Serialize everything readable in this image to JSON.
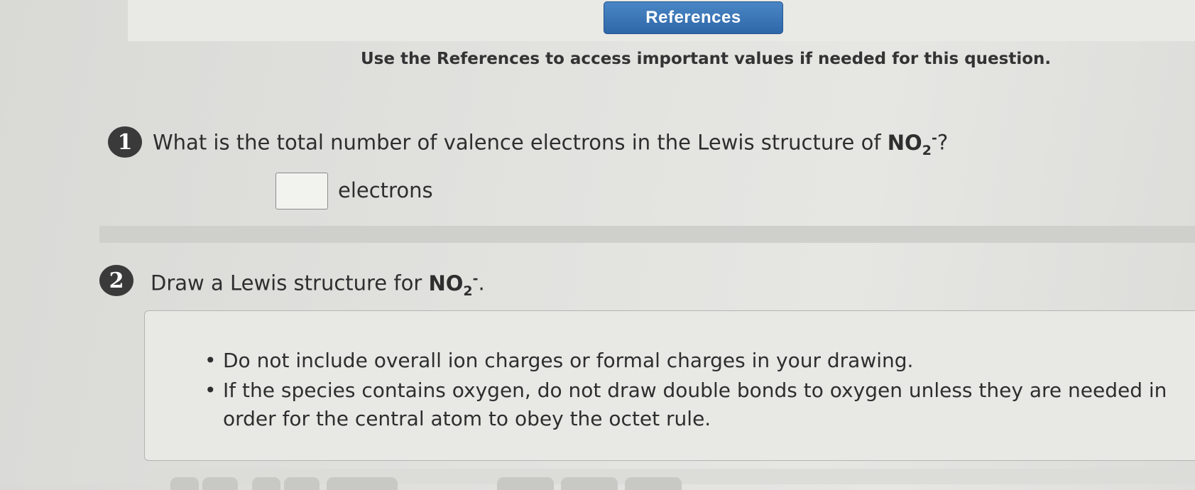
{
  "header": {
    "references_label": "References",
    "instruction": "Use the References to access important values if needed for this question."
  },
  "question1": {
    "number": "1",
    "text_before": "What is the total number of valence electrons in the Lewis structure of ",
    "formula_base": "NO",
    "formula_sub": "2",
    "formula_sup": "-",
    "text_after": "?",
    "answer_value": "",
    "unit_label": "electrons"
  },
  "question2": {
    "number": "2",
    "text_before": "Draw a Lewis structure for ",
    "formula_base": "NO",
    "formula_sub": "2",
    "formula_sup": "-",
    "text_after": ".",
    "bullets": [
      "Do not include overall ion charges or formal charges in your drawing.",
      "If the species contains oxygen, do not draw double bonds to oxygen unless they are needed in order for the central atom to obey the octet rule."
    ]
  },
  "colors": {
    "references_button": "#3a77b8",
    "badge": "#3a3a3a"
  }
}
